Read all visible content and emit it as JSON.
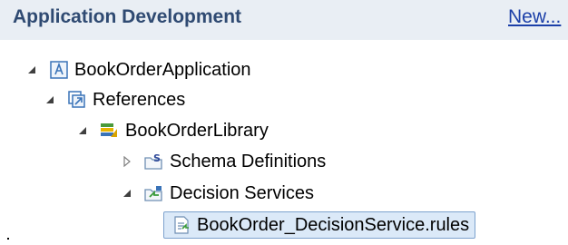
{
  "header": {
    "title": "Application Development",
    "new_link": "New..."
  },
  "tree": [
    {
      "label": "BookOrderApplication",
      "icon": "application-icon",
      "state": "expanded"
    },
    {
      "label": "References",
      "icon": "references-icon",
      "state": "expanded"
    },
    {
      "label": "BookOrderLibrary",
      "icon": "library-icon",
      "state": "expanded"
    },
    {
      "label": "Schema Definitions",
      "icon": "schema-definitions-icon",
      "state": "collapsed"
    },
    {
      "label": "Decision Services",
      "icon": "decision-services-icon",
      "state": "expanded"
    },
    {
      "label": "BookOrder_DecisionService.rules",
      "icon": "rules-file-icon",
      "state": "selected"
    }
  ],
  "colors": {
    "header_background": "#e9eef4",
    "header_title": "#2f4a72",
    "link": "#1b3fa8",
    "selection_background": "#dbe9f8",
    "selection_border": "#7da2ce"
  }
}
